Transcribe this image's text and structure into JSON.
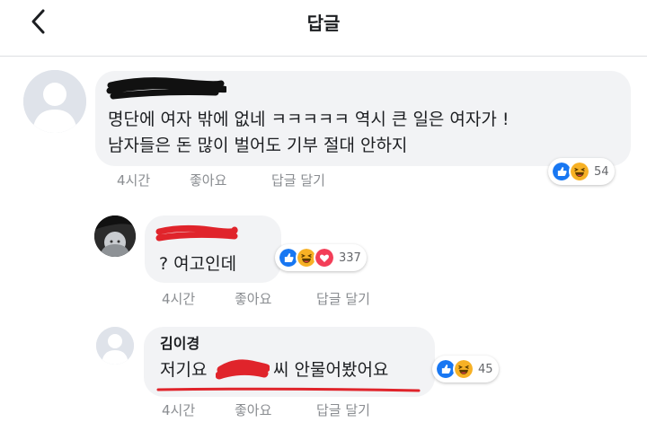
{
  "header": {
    "title": "답글"
  },
  "colors": {
    "like": "#1877f2",
    "haha": "#f7b125",
    "love": "#f33e58",
    "redact": "#111111",
    "redact_red": "#e0242b",
    "underline": "#e0242b"
  },
  "comments": [
    {
      "author": "",
      "lines": [
        "명단에 여자 밖에 없네 ㅋㅋㅋㅋㅋ 역시 큰 일은 여자가 !",
        "남자들은 돈 많이 벌어도 기부 절대 안하지"
      ],
      "time": "4시간",
      "like": "좋아요",
      "reply": "답글 달기",
      "reactions": [
        "like-icon",
        "haha-icon"
      ],
      "reaction_count": "54"
    },
    {
      "author": "",
      "lines": [
        "? 여고인데"
      ],
      "time": "4시간",
      "like": "좋아요",
      "reply": "답글 달기",
      "reactions": [
        "like-icon",
        "haha-icon",
        "love-icon"
      ],
      "reaction_count": "337"
    },
    {
      "author": "김이경",
      "text_before": "저기요",
      "text_after": "씨 안물어봤어요",
      "time": "4시간",
      "like": "좋아요",
      "reply": "답글 달기",
      "reactions": [
        "like-icon",
        "haha-icon"
      ],
      "reaction_count": "45"
    }
  ]
}
